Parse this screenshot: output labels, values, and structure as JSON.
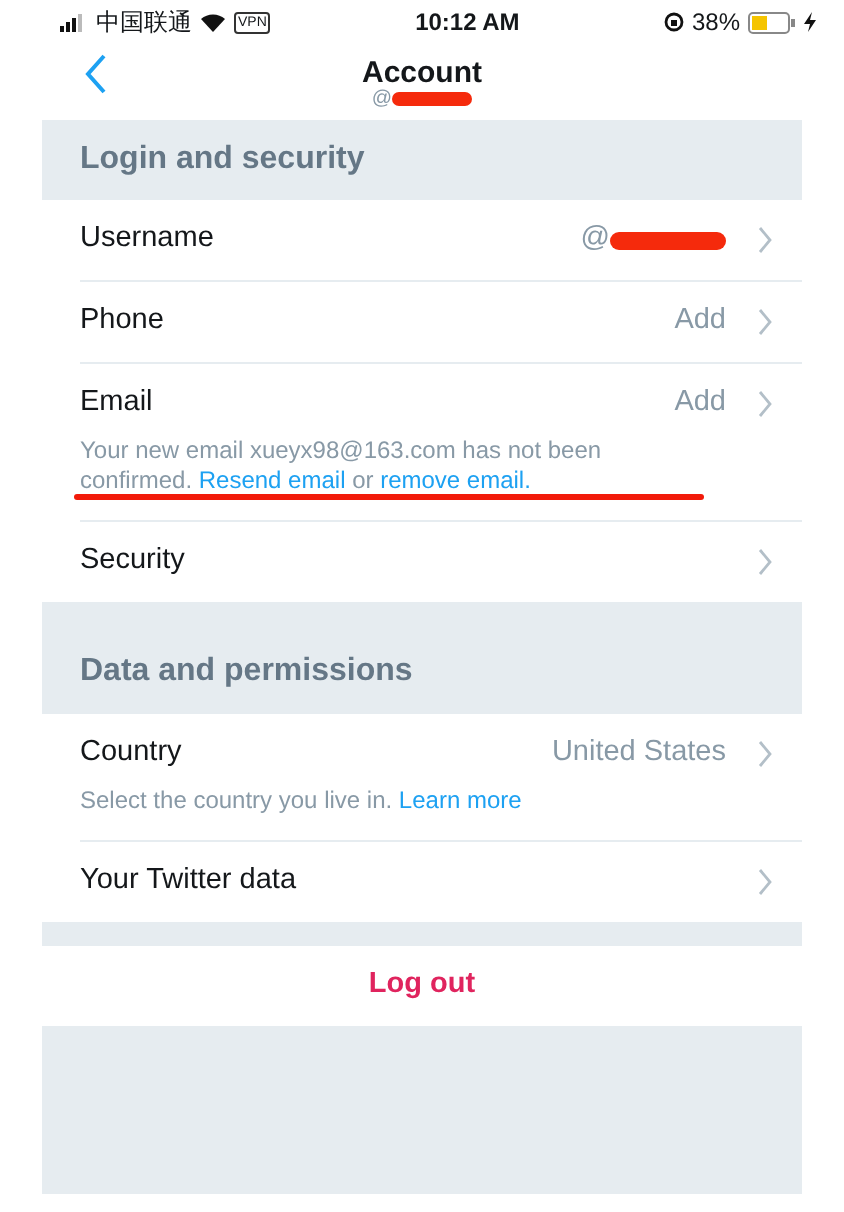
{
  "status_bar": {
    "carrier": "中国联通",
    "vpn": "VPN",
    "time": "10:12 AM",
    "battery": "38%"
  },
  "nav": {
    "title": "Account",
    "subtitle": "@",
    "subtitle_redacted": true
  },
  "sections": [
    {
      "title": "Login and security",
      "rows": [
        {
          "label": "Username",
          "value": "@",
          "redacted": true
        },
        {
          "label": "Phone",
          "value": "Add"
        },
        {
          "label": "Email",
          "value": "Add",
          "note_underlined": true,
          "note": [
            {
              "kind": "text",
              "text": "Your new email xueyx98@163.com has not been confirmed. "
            },
            {
              "kind": "link",
              "text": "Resend email"
            },
            {
              "kind": "text",
              "text": " or "
            },
            {
              "kind": "link",
              "text": "remove email."
            }
          ]
        },
        {
          "label": "Security"
        }
      ]
    },
    {
      "title": "Data and permissions",
      "rows": [
        {
          "label": "Country",
          "value": "United States",
          "note": [
            {
              "kind": "text",
              "text": "Select the country you live in. "
            },
            {
              "kind": "link",
              "text": "Learn more"
            }
          ]
        },
        {
          "label": "Your Twitter data"
        }
      ]
    }
  ],
  "logout": "Log out"
}
